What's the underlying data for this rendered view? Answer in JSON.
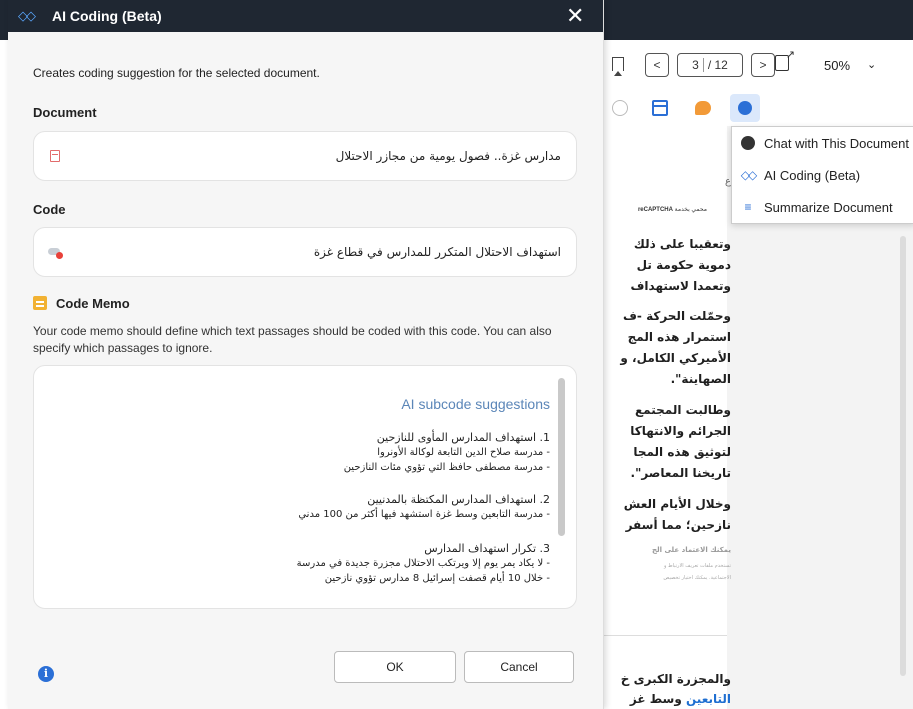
{
  "viewer": {
    "page_current": "3",
    "page_total": "/ 12",
    "prev_arrow": "<",
    "next_arrow": ">",
    "zoom": "50%",
    "zoom_caret": "⌄",
    "ai_menu": [
      {
        "label": "Chat with This Document",
        "icon": "chat-icon"
      },
      {
        "label": "AI Coding (Beta)",
        "icon": "ai-coding-icon"
      },
      {
        "label": "Summarize Document",
        "icon": "summarize-icon"
      }
    ],
    "document_fragments": [
      "ع",
      "محمي بخدمة",
      "reCAPTCHA",
      "وتعقيبا على ذلك",
      "دموية حكومة تل",
      "وتعمدا لاستهداف",
      "وحمّلت الحركة -ف",
      "استمرار هذه المج",
      "الأميركي الكامل، و",
      "الصهاينة\".",
      "وطالبت المجتمع",
      "الجرائم والانتهاكا",
      "لتوثيق هذه المجا",
      "تاريخنا المعاصر\".",
      "وخلال الأيام العش",
      "نازحين؛ مما أسفر",
      "يمكنك الاعتماد على الج",
      "تستخدم ملفات تعريف الارتباط و",
      "الاجتماعية. يمكنك اختيار تخصيص",
      "والمجزرة الكبرى خ",
      "التابعين",
      "وسط غز"
    ]
  },
  "dialog": {
    "title": "AI Coding (Beta)",
    "close": "✕",
    "description": "Creates coding suggestion for the selected document.",
    "document_label": "Document",
    "document_value": "مدارس غزة.. فصول يومية من مجازر الاحتلال",
    "code_label": "Code",
    "code_value": "استهداف الاحتلال المتكرر للمدارس في قطاع غزة",
    "memo_label": "Code Memo",
    "memo_description": "Your code memo should define which text passages should be coded with this code. You can also specify which passages to ignore.",
    "memo": {
      "heading": "AI subcode suggestions",
      "lines": [
        "1. استهداف المدارس المأوى للنازحين",
        "- مدرسة صلاح الدين التابعة لوكالة الأونروا",
        "- مدرسة مصطفى حافظ التي تؤوي مئات النازحين",
        "2. استهداف المدارس المكتظة بالمدنيين",
        "- مدرسة التابعين وسط غزة استشهد فيها أكثر من 100 مدني",
        "3. تكرار استهداف المدارس",
        "- لا يكاد يمر يوم إلا ويرتكب الاحتلال مجزرة جديدة في مدرسة",
        "- خلال 10 أيام قصفت إسرائيل 8 مدارس تؤوي نازحين"
      ]
    },
    "ok_label": "OK",
    "cancel_label": "Cancel",
    "info": "i"
  }
}
